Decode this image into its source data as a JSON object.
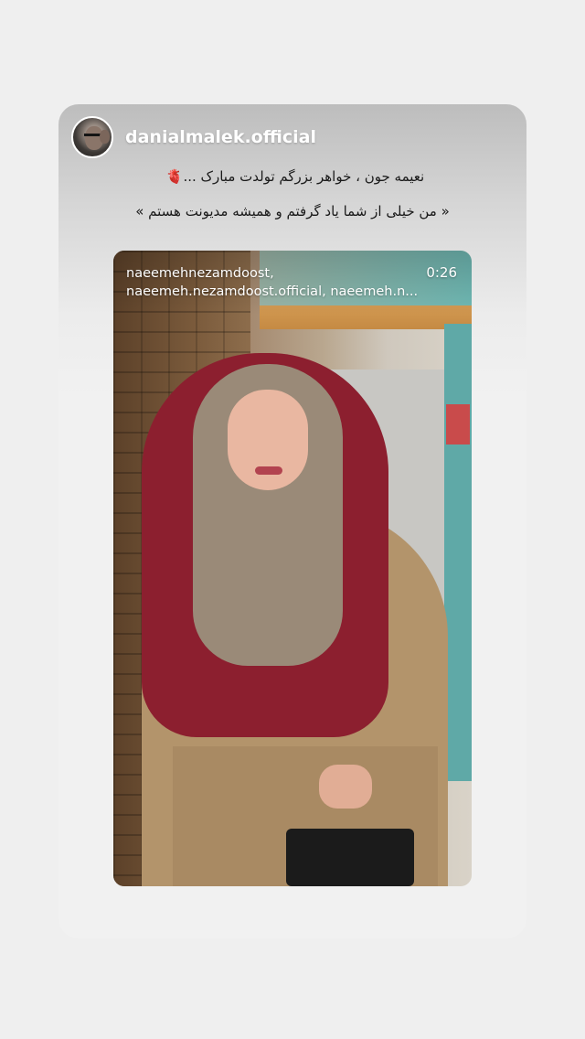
{
  "post": {
    "username": "danialmalek.official",
    "caption_line_1": "نعیمه جون ، خواهر بزرگم تولدت مبارک ...",
    "caption_heart": "🫀",
    "caption_line_2": "« من خیلی از شما یاد گرفتم و همیشه مدیونت هستم »"
  },
  "video": {
    "tagged_line_1": "naeemehnezamdoost,",
    "tagged_line_2": "naeemeh.nezamdoost.official, naeemeh.n...",
    "duration": "0:26"
  },
  "colors": {
    "background": "#efefef",
    "card_top": "#bdbdbd",
    "scarf": "#8c1f2f"
  },
  "icons": {
    "avatar": "profile-photo"
  }
}
